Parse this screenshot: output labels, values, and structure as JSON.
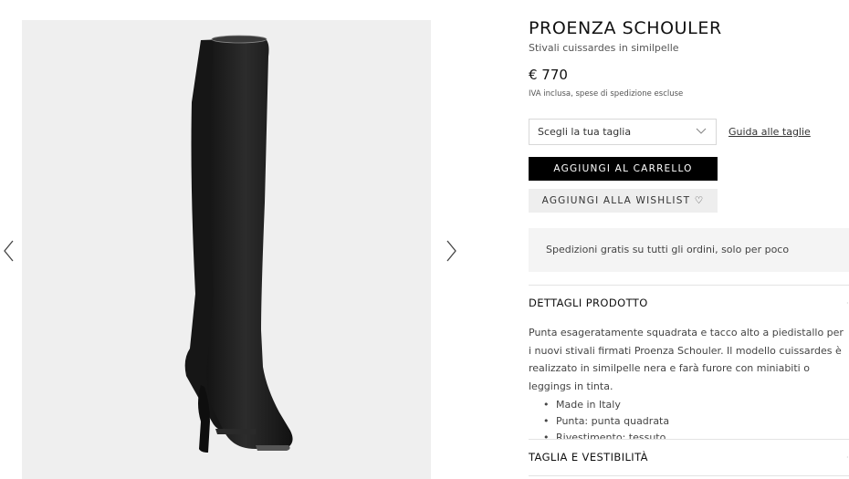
{
  "gallery": {
    "prev_icon": "chevron-left-icon",
    "next_icon": "chevron-right-icon"
  },
  "product": {
    "brand": "PROENZA SCHOULER",
    "name": "Stivali cuissardes in similpelle",
    "price": "€ 770",
    "tax_note": "IVA inclusa, spese di spedizione escluse"
  },
  "size": {
    "selected": "Scegli la tua taglia",
    "guide_label": "Guida alle taglie"
  },
  "actions": {
    "add_to_cart": "AGGIUNGI AL CARRELLO",
    "add_to_wishlist": "AGGIUNGI ALLA WISHLIST ♡"
  },
  "shipping": {
    "text": "Spedizioni gratis su tutti gli ordini, solo per poco"
  },
  "details": {
    "title": "DETTAGLI PRODOTTO",
    "description": "Punta esageratamente squadrata e tacco alto a piedistallo per i nuovi stivali firmati Proenza Schouler. Il modello cuissardes è realizzato in similpelle nera e farà furore con miniabiti o leggings in tinta.",
    "bullets": [
      "Made in Italy",
      "Punta: punta quadrata",
      "Rivestimento: tessuto"
    ]
  },
  "fit": {
    "title": "TAGLIA E VESTIBILITÀ"
  },
  "colors": {
    "boot": "#1e1e1e",
    "cart_button": "#000000",
    "wishlist_button": "#eeeeee",
    "gallery_bg": "#efefef"
  }
}
